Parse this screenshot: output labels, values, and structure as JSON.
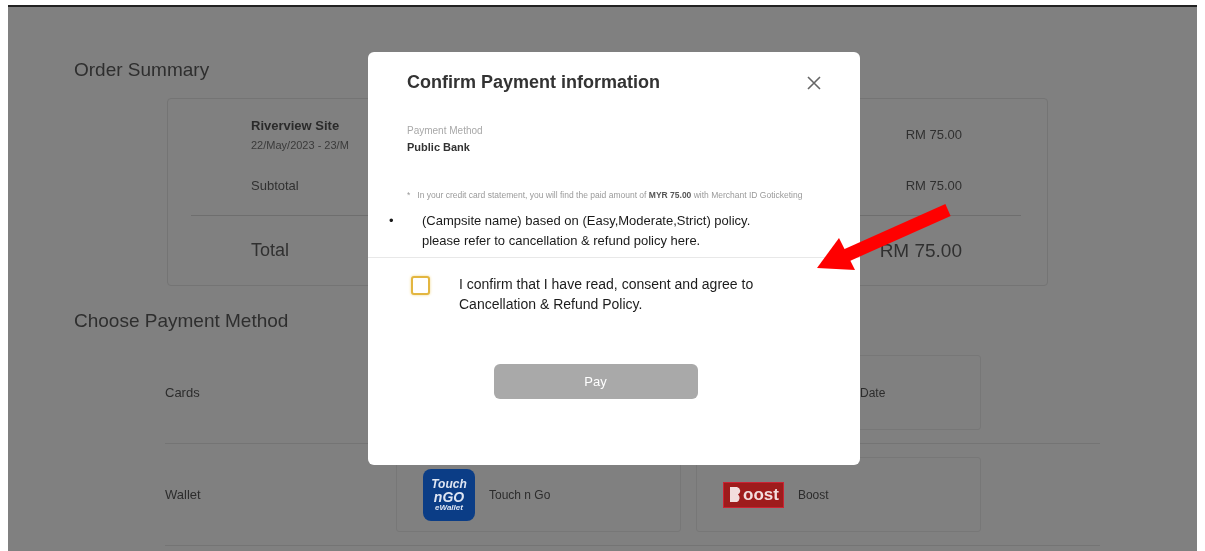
{
  "order_summary": {
    "title": "Order Summary",
    "items": [
      {
        "name": "Riverview Site",
        "dates": "22/May/2023 - 23/M",
        "price": "RM 75.00"
      }
    ],
    "subtotal": {
      "label": "Subtotal",
      "value": "RM 75.00"
    },
    "total": {
      "label": "Total",
      "value": "RM 75.00"
    }
  },
  "payment_methods": {
    "title": "Choose Payment Method",
    "groups": [
      {
        "label": "Cards",
        "options": [
          {
            "kind": "text",
            "label": "Date"
          }
        ]
      },
      {
        "label": "Wallet",
        "options": [
          {
            "kind": "tng",
            "label": "Touch n Go",
            "logo_texts": [
              "Touch",
              "nGO",
              "eWallet"
            ]
          },
          {
            "kind": "boost",
            "label": "Boost",
            "logo_texts": [
              "oost"
            ]
          }
        ]
      }
    ]
  },
  "dialog": {
    "title": "Confirm Payment information",
    "method_label": "Payment Method",
    "method_value": "Public Bank",
    "note_mark": "*",
    "note": "In your credit card statement, you will find the paid amount of **MYR 75.00** with Merchant ID Goticketing",
    "bullet": "•",
    "policy_text": "(Campsite name) based on (Easy,Moderate,Strict) policy.\nplease refer to cancellation & refund policy here.",
    "checkbox": {
      "label": "I confirm that I have read, consent and agree to\nCancellation & Refund Policy.",
      "checked": false
    },
    "pay_button": {
      "label": "Pay",
      "disabled": true
    }
  }
}
